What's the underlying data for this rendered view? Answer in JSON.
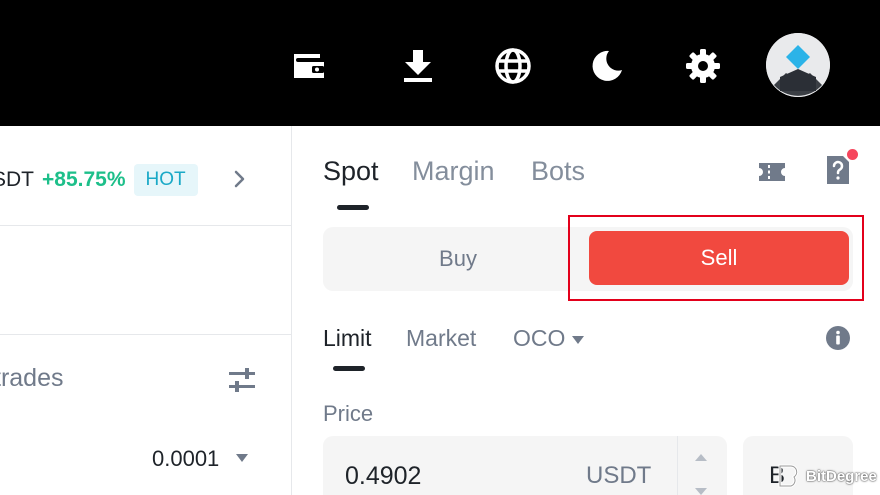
{
  "header": {
    "icons": [
      "wallet-icon",
      "download-icon",
      "globe-icon",
      "moon-icon",
      "gear-icon"
    ],
    "avatar": "user-avatar"
  },
  "market": {
    "pair_fragment": "SDT",
    "change": "+85.75%",
    "badge": "HOT",
    "trades_label": "trades",
    "tick_size": "0.0001"
  },
  "trade_panel": {
    "tabs": [
      {
        "label": "Spot",
        "active": true
      },
      {
        "label": "Margin",
        "active": false
      },
      {
        "label": "Bots",
        "active": false
      }
    ],
    "buy_label": "Buy",
    "sell_label": "Sell",
    "order_types": [
      {
        "label": "Limit",
        "active": true
      },
      {
        "label": "Market",
        "active": false
      },
      {
        "label": "OCO",
        "active": false
      }
    ],
    "price_label": "Price",
    "price_value": "0.4902",
    "price_unit": "USDT",
    "side_box_text": "B"
  },
  "watermark": {
    "text": "BitDegree"
  },
  "colors": {
    "positive": "#1dbf8a",
    "sell": "#f1493f",
    "highlight": "#e3001b",
    "badge_bg": "#e6f6fa",
    "badge_text": "#1aa9c7"
  }
}
